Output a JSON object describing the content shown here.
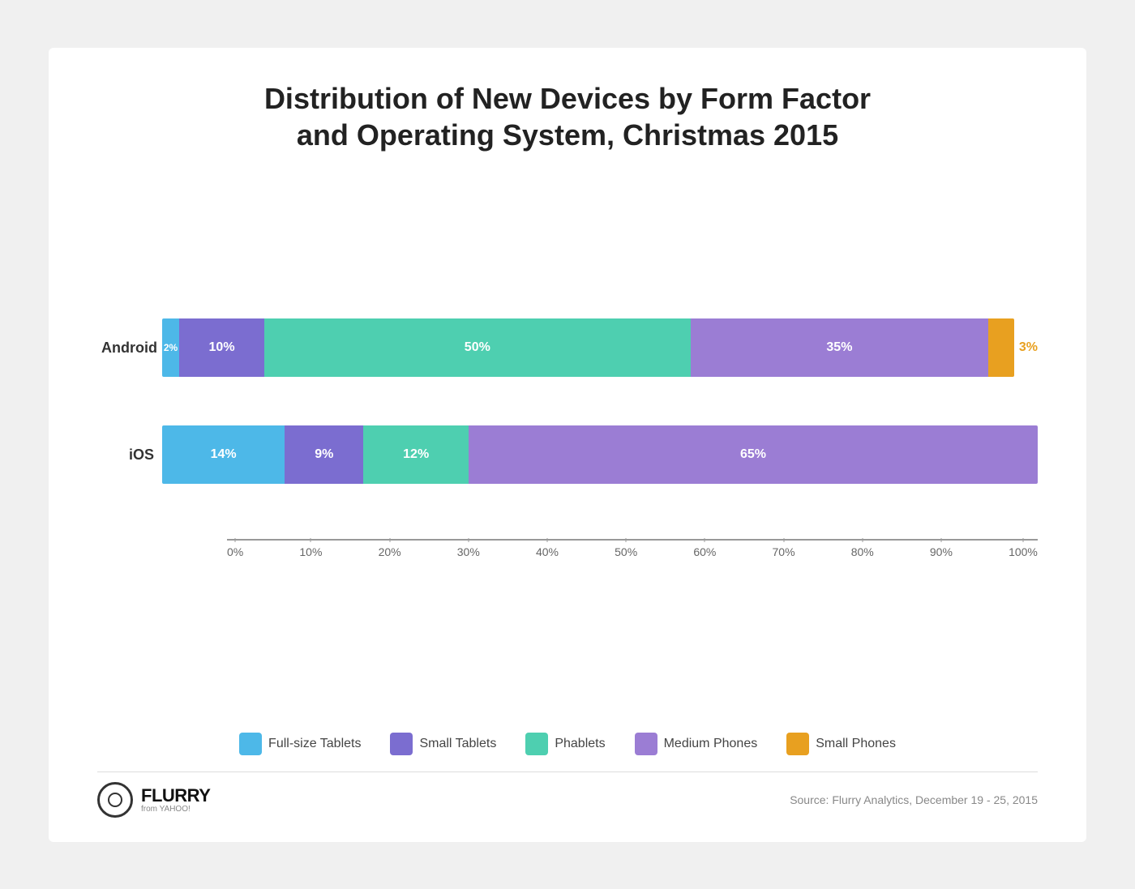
{
  "page": {
    "background": "#f0f0f0"
  },
  "chart": {
    "title_line1": "Distribution of New Devices by Form Factor",
    "title_line2": "and Operating System, Christmas 2015",
    "bars": [
      {
        "id": "android",
        "label": "Android",
        "segments": [
          {
            "id": "fullsize",
            "pct": 2,
            "label": "2%",
            "color": "#4db8e8",
            "show_inside": true
          },
          {
            "id": "small-tablets",
            "pct": 10,
            "label": "10%",
            "color": "#7b6dd0",
            "show_inside": true
          },
          {
            "id": "phablets",
            "pct": 50,
            "label": "50%",
            "color": "#4ecfb0",
            "show_inside": true
          },
          {
            "id": "medium-phones",
            "pct": 35,
            "label": "35%",
            "color": "#9b7dd4",
            "show_inside": true
          },
          {
            "id": "small-phones",
            "pct": 3,
            "label": "3%",
            "color": "#e8a020",
            "show_inside": false
          }
        ]
      },
      {
        "id": "ios",
        "label": "iOS",
        "segments": [
          {
            "id": "fullsize",
            "pct": 14,
            "label": "14%",
            "color": "#4db8e8",
            "show_inside": true
          },
          {
            "id": "small-tablets",
            "pct": 9,
            "label": "9%",
            "color": "#7b6dd0",
            "show_inside": true
          },
          {
            "id": "phablets",
            "pct": 12,
            "label": "12%",
            "color": "#4ecfb0",
            "show_inside": true
          },
          {
            "id": "medium-phones",
            "pct": 65,
            "label": "65%",
            "color": "#9b7dd4",
            "show_inside": true
          }
        ]
      }
    ],
    "x_axis": {
      "ticks": [
        "0%",
        "10%",
        "20%",
        "30%",
        "40%",
        "50%",
        "60%",
        "70%",
        "80%",
        "90%",
        "100%"
      ]
    },
    "legend": [
      {
        "id": "fullsize-tablets",
        "label": "Full-size Tablets",
        "color": "#4db8e8"
      },
      {
        "id": "small-tablets",
        "label": "Small Tablets",
        "color": "#7b6dd0"
      },
      {
        "id": "phablets",
        "label": "Phablets",
        "color": "#4ecfb0"
      },
      {
        "id": "medium-phones",
        "label": "Medium Phones",
        "color": "#9b7dd4"
      },
      {
        "id": "small-phones",
        "label": "Small Phones",
        "color": "#e8a020"
      }
    ]
  },
  "footer": {
    "logo_name": "FLURRY",
    "logo_sub": "from YAHOO!",
    "source": "Source: Flurry Analytics, December 19 - 25, 2015"
  }
}
